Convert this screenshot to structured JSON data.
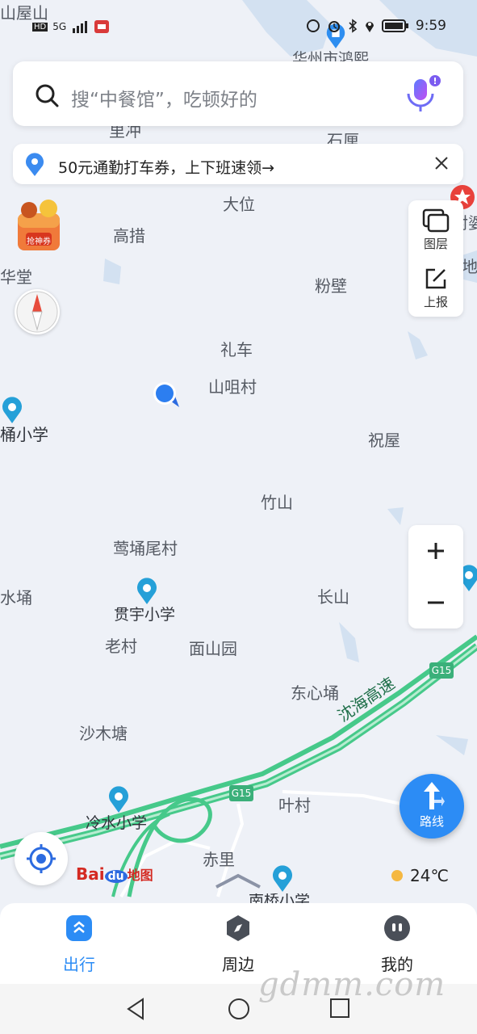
{
  "status_bar": {
    "time": "9:59",
    "left_indicator": "HD",
    "network": "5G"
  },
  "search": {
    "placeholder": "搜“中餐馆”，吃顿好的"
  },
  "promo": {
    "text": "50元通勤打车券，上下班速领→"
  },
  "side_panel": {
    "layers_label": "图层",
    "report_label": "上报"
  },
  "gift": {
    "label": "抢神券"
  },
  "map_places": [
    "山屋山",
    "华州市鸿熙",
    "里冲",
    "石厘",
    "大位",
    "高措",
    "华堂",
    "粉壁",
    "礼车",
    "山咀村",
    "祝屋",
    "竹山",
    "莺埇尾村",
    "长山",
    "老村",
    "面山园",
    "东心埇",
    "沙木塘",
    "叶村",
    "赤里",
    "桶小学",
    "水埇",
    "封婆",
    "地"
  ],
  "pois": [
    {
      "label": "贯宇小学"
    },
    {
      "label": "冷水小学"
    },
    {
      "label": "南桥小学"
    }
  ],
  "roads": {
    "expressway_name": "沈海高速",
    "shield_1": "G15",
    "shield_2": "G15"
  },
  "route_button": {
    "label": "路线"
  },
  "logo": {
    "text_bai": "Bai",
    "text_du": "du",
    "text_map": "地图"
  },
  "weather": {
    "temp": "24℃"
  },
  "tabs": [
    {
      "label": "出行",
      "active": true
    },
    {
      "label": "周边",
      "active": false
    },
    {
      "label": "我的",
      "active": false
    }
  ],
  "watermark": "gdmm.com",
  "colors": {
    "accent": "#2c8cf5",
    "road": "#46c98a",
    "water": "#d3e1f1"
  }
}
